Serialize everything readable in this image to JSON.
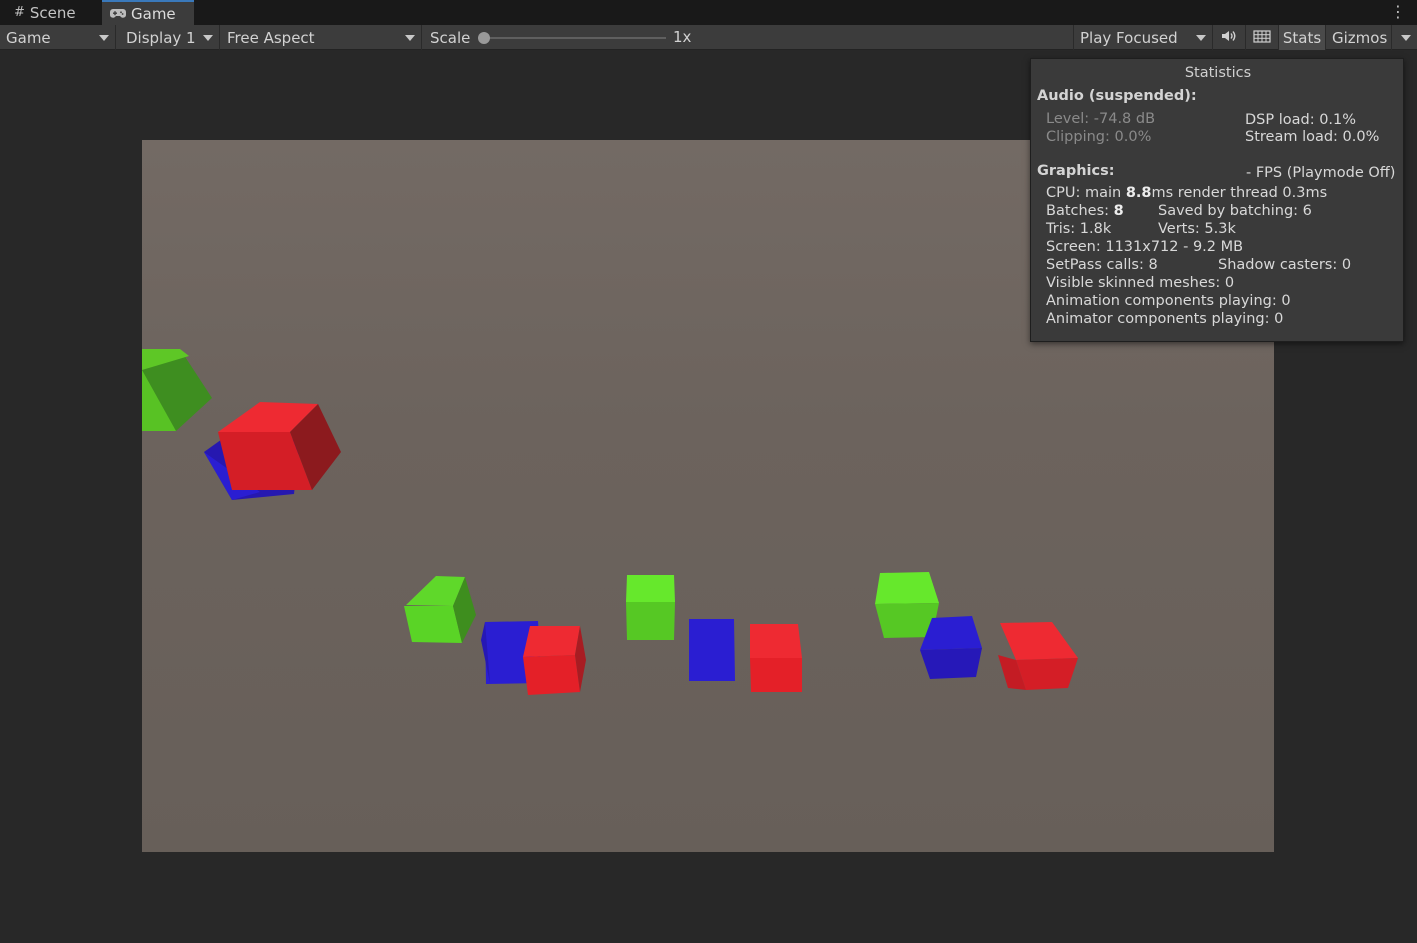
{
  "tabs": [
    {
      "label": "Scene",
      "icon": "grid-hash-icon"
    },
    {
      "label": "Game",
      "icon": "gamepad-icon"
    }
  ],
  "toolbar": {
    "game_dropdown": "Game",
    "display_dropdown": "Display 1",
    "aspect_dropdown": "Free Aspect",
    "scale_label": "Scale",
    "scale_value": "1x",
    "scale_fraction": 0.0,
    "play_mode_dropdown": "Play Focused",
    "audio_icon": "speaker-icon",
    "grid_icon": "grid-icon",
    "stats_label": "Stats",
    "gizmos_label": "Gizmos"
  },
  "statistics": {
    "title": "Statistics",
    "audio_heading": "Audio (suspended):",
    "level": "Level: -74.8 dB",
    "clipping": "Clipping: 0.0%",
    "dsp_load": "DSP load: 0.1%",
    "stream_load": "Stream load: 0.0%",
    "graphics_heading": "Graphics:",
    "fps": "- FPS (Playmode Off)",
    "cpu_prefix": "CPU: main ",
    "cpu_main": "8.8",
    "cpu_suffix": "ms  render thread 0.3ms",
    "batches_prefix": "Batches: ",
    "batches": "8",
    "saved_by_batching": "Saved by batching: 6",
    "tris": "Tris: 1.8k",
    "verts": "Verts: 5.3k",
    "screen": "Screen: 1131x712 - 9.2 MB",
    "setpass": "SetPass calls: 8",
    "shadow_casters": "Shadow casters: 0",
    "skinned_meshes": "Visible skinned meshes: 0",
    "animation_components": "Animation components playing: 0",
    "animator_components": "Animator components playing: 0"
  },
  "colors": {
    "cube_red": "#e8202a",
    "cube_green": "#6ae82a",
    "cube_blue": "#2a1ed2",
    "ground": "#6c635d"
  }
}
